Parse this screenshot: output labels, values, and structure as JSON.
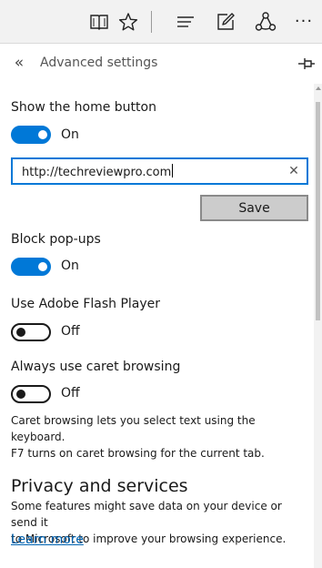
{
  "toolbar": {
    "reading_view_icon": "book-icon",
    "favorite_icon": "star-icon",
    "hub_icon": "hub-lines-icon",
    "notes_icon": "pen-square-icon",
    "share_icon": "share-icon",
    "more_label": "···"
  },
  "panel": {
    "back_label": "«",
    "title": "Advanced settings",
    "pin_icon": "pin-icon"
  },
  "settings": {
    "home_button": {
      "label": "Show the home button",
      "state": "On",
      "enabled": true,
      "url_value": "http://techreviewpro.com",
      "clear_label": "✕",
      "save_label": "Save"
    },
    "popups": {
      "label": "Block pop-ups",
      "state": "On",
      "enabled": true
    },
    "flash": {
      "label": "Use Adobe Flash Player",
      "state": "Off",
      "enabled": false
    },
    "caret": {
      "label": "Always use caret browsing",
      "state": "Off",
      "enabled": false,
      "description_line1": "Caret browsing lets you select text using the keyboard.",
      "description_line2": "F7 turns on caret browsing for the current tab."
    }
  },
  "privacy": {
    "title": "Privacy and services",
    "description_line1": "Some features might save data on your device or send it",
    "description_line2": "to Microsoft to improve your browsing experience.",
    "learn_more": "Learn more"
  },
  "colors": {
    "accent": "#0078d7",
    "link": "#0063b1",
    "toolbar_bg": "#f2f2f2"
  }
}
